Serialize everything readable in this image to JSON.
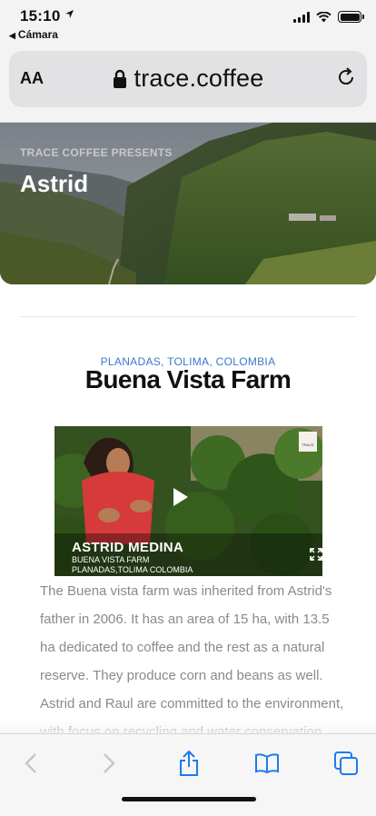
{
  "status_bar": {
    "time": "15:10",
    "location_arrow": "location-arrow-icon",
    "back_app": "Cámara"
  },
  "browser": {
    "text_size_button": "AA",
    "url": "trace.coffee",
    "lock_icon": "lock-icon",
    "reload_icon": "reload-icon"
  },
  "hero": {
    "eyebrow": "TRACE COFFEE PRESENTS",
    "title": "Astrid"
  },
  "farm": {
    "location": "PLANADAS, TOLIMA, COLOMBIA",
    "title": "Buena Vista Farm"
  },
  "video": {
    "logo_text": "TRACE",
    "name": "ASTRID MEDINA",
    "farm": "BUENA VISTA FARM",
    "region": "PLANADAS,TOLIMA COLOMBIA"
  },
  "body": {
    "text": "The Buena vista farm was inherited from Astrid's father in 2006. It has an area of 15 ha, with 13.5 ha dedicated to coffee and the rest as a natural reserve. They produce corn and beans as well. Astrid and Raul are committed to the environment, with focus on recycling and water conservation."
  },
  "toolbar": {
    "back": "chevron-left-icon",
    "forward": "chevron-right-icon",
    "share": "share-icon",
    "bookmarks": "book-icon",
    "tabs": "tabs-icon"
  },
  "colors": {
    "accent_blue": "#3d78c9",
    "ios_blue": "#1f7aec",
    "body_text": "#8a8a8a"
  }
}
